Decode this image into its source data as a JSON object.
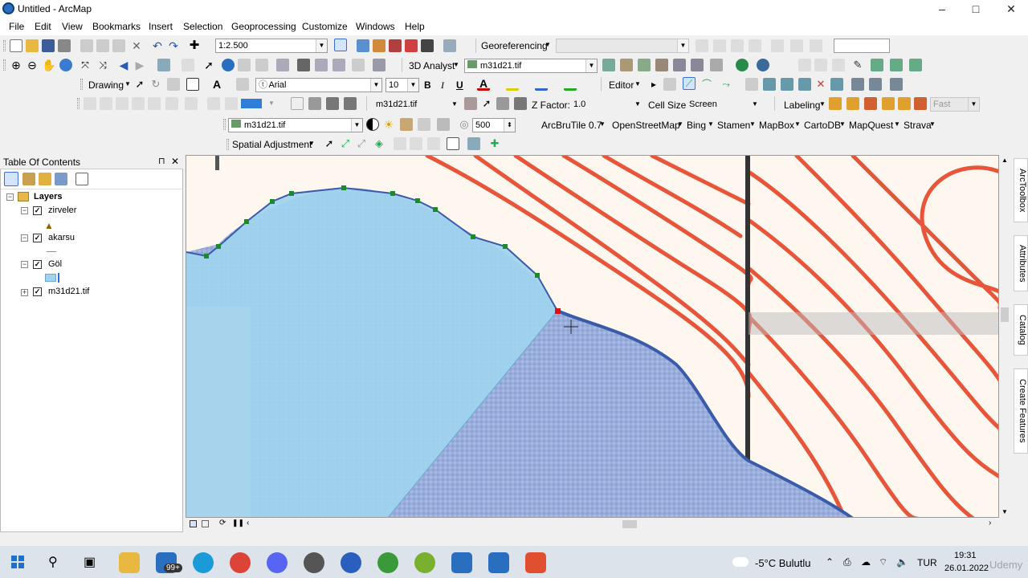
{
  "window": {
    "title": "Untitled - ArcMap",
    "minimize": "–",
    "maximize": "□",
    "close": "✕"
  },
  "menu": [
    "File",
    "Edit",
    "View",
    "Bookmarks",
    "Insert",
    "Selection",
    "Geoprocessing",
    "Customize",
    "Windows",
    "Help"
  ],
  "toolbar": {
    "scale": "1:2.500",
    "georeferencing_label": "Georeferencing",
    "analyst3d_label": "3D Analyst",
    "analyst_layer": "m31d21.tif",
    "drawing_label": "Drawing",
    "font_name": "Arial",
    "font_size": "10",
    "bold": "B",
    "italic": "I",
    "underline": "U",
    "editor_label": "Editor",
    "surface_layer": "m31d21.tif",
    "zfactor_label": "Z Factor:",
    "zfactor_value": "1.0",
    "cellsize_label": "Cell Size:",
    "cellsize_value": "Screen",
    "labeling_label": "Labeling",
    "fast_label": "Fast",
    "image_layer": "m31d21.tif",
    "contrast_value": "500",
    "basemaps": [
      "ArcBruTile 0.7",
      "OpenStreetMap",
      "Bing",
      "Stamen",
      "MapBox",
      "CartoDB",
      "MapQuest",
      "Strava"
    ],
    "spatial_adjustment_label": "Spatial Adjustment"
  },
  "toc": {
    "title": "Table Of Contents",
    "root": "Layers",
    "layers": [
      {
        "name": "zirveler",
        "checked": true
      },
      {
        "name": "akarsu",
        "checked": true
      },
      {
        "name": "Göl",
        "checked": true
      },
      {
        "name": "m31d21.tif",
        "checked": true
      }
    ]
  },
  "right_tabs": [
    "ArcToolbox",
    "Attributes",
    "Catalog",
    "Create Features"
  ],
  "taskbar": {
    "weather": "-5°C Bulutlu",
    "language": "TUR",
    "time": "19:31",
    "date": "26.01.2022",
    "mail_badge": "99+"
  },
  "watermark": "Udemy",
  "colors": {
    "lake": "#9fd3ee",
    "contour": "#e8553a",
    "sketch_vertex": "#1a8a2a",
    "selected_vertex": "#e01010",
    "edge": "#3a5ba8"
  }
}
